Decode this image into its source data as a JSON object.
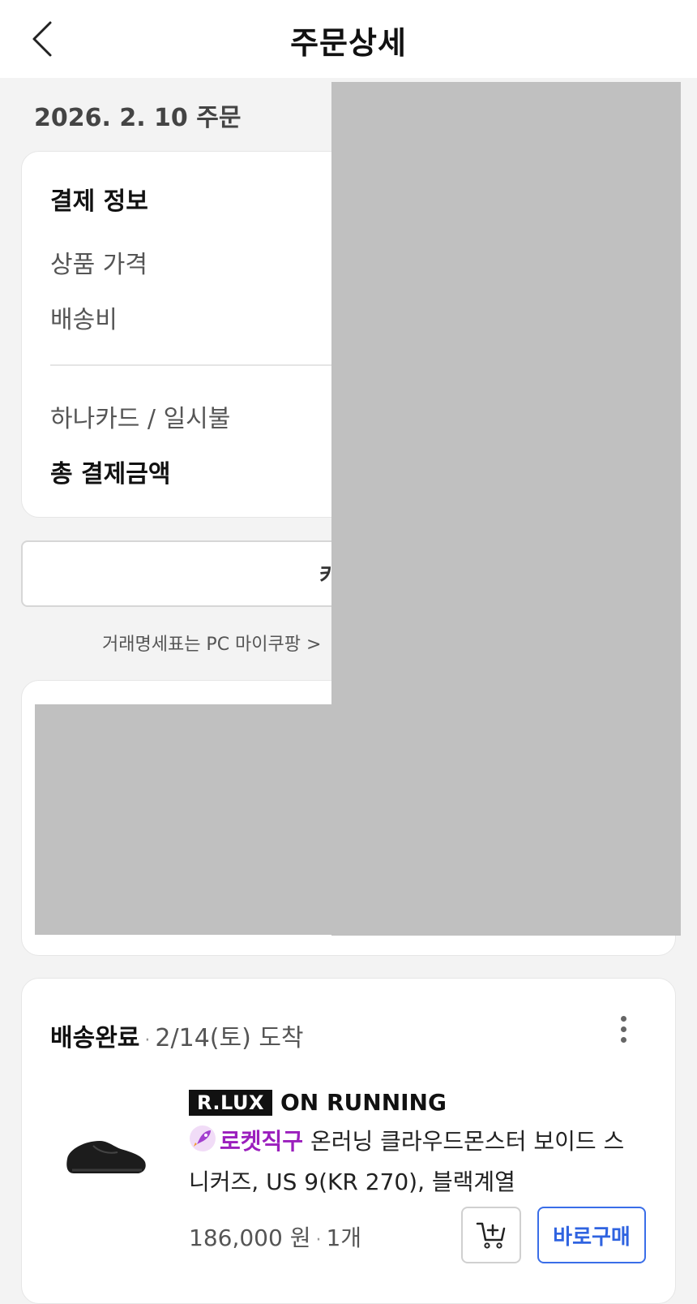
{
  "header": {
    "title": "주문상세"
  },
  "order": {
    "date_label": "2026. 2. 10 주문"
  },
  "payment": {
    "title": "결제 정보",
    "rows": [
      "상품 가격",
      "배송비"
    ],
    "method": "하나카드 / 일시불",
    "total_label": "총 결제금액"
  },
  "receipt_button": {
    "label": "카드영"
  },
  "note": {
    "text": "거래명세표는 PC 마이쿠팡 >"
  },
  "delivery": {
    "status": "배송완료",
    "arrival": "2/14(토) 도착",
    "badge": "R.LUX",
    "brand": "ON RUNNING",
    "rocket_label": "로켓직구",
    "product_name": "온러닝 클라우드몬스터 보이드 스니커즈, US 9(KR 270), 블랙계열",
    "price": "186,000 원",
    "quantity": "1개",
    "buy_now_label": "바로구매"
  },
  "colors": {
    "accent_blue": "#2f63e0",
    "rocket_purple": "#9b1fbd",
    "redaction_gray": "#c0c0c0"
  },
  "icons": [
    "back-icon",
    "kebab-menu-icon",
    "rocket-icon",
    "add-to-cart-icon"
  ]
}
